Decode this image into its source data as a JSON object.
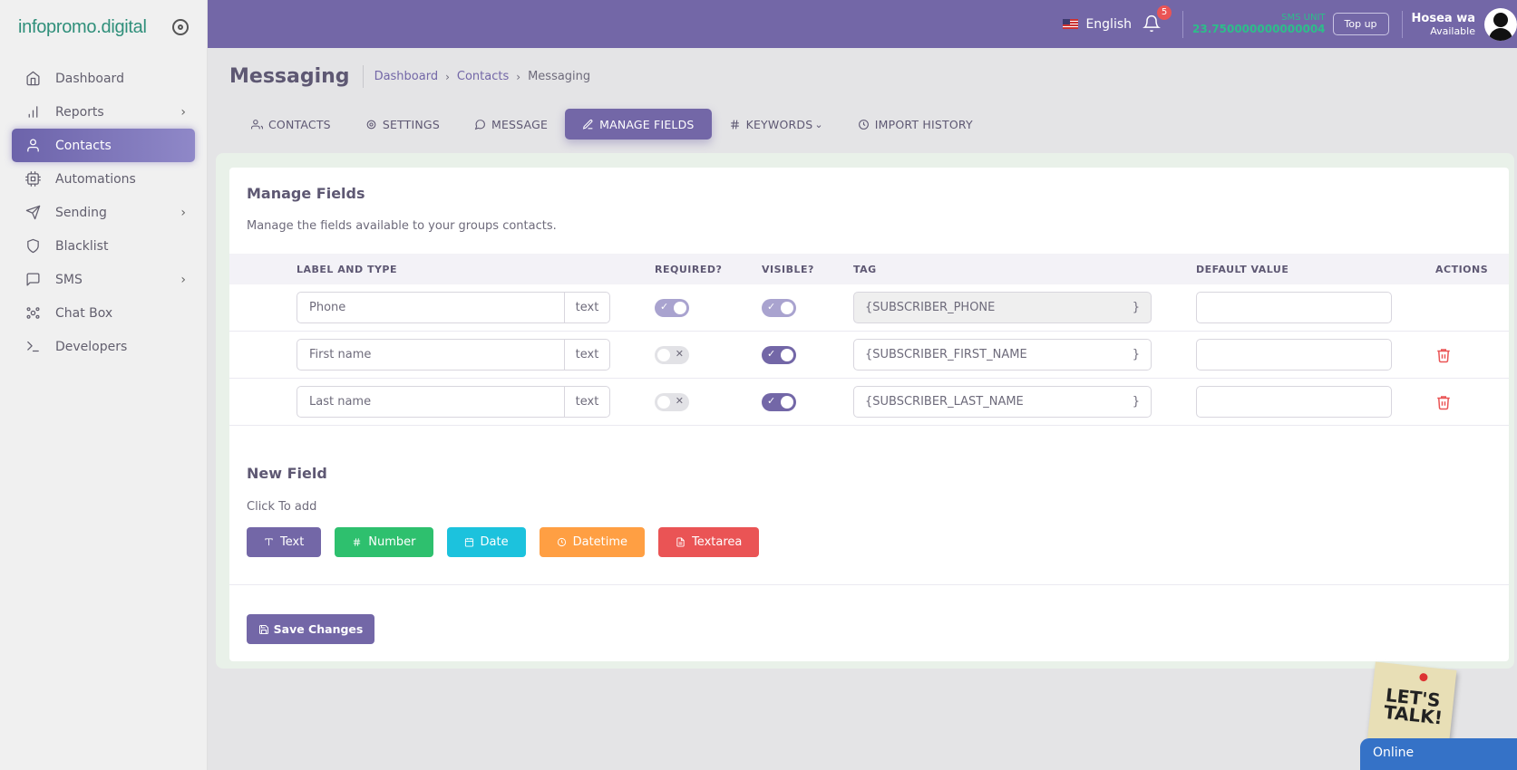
{
  "brand": {
    "name": "infopromo.digital"
  },
  "sidebar": {
    "items": [
      {
        "label": "Dashboard",
        "icon": "home-icon",
        "has_arrow": false,
        "active": false
      },
      {
        "label": "Reports",
        "icon": "bar-chart-icon",
        "has_arrow": true,
        "active": false
      },
      {
        "label": "Contacts",
        "icon": "user-icon",
        "has_arrow": false,
        "active": true
      },
      {
        "label": "Automations",
        "icon": "cpu-icon",
        "has_arrow": false,
        "active": false
      },
      {
        "label": "Sending",
        "icon": "send-icon",
        "has_arrow": true,
        "active": false
      },
      {
        "label": "Blacklist",
        "icon": "shield-icon",
        "has_arrow": false,
        "active": false
      },
      {
        "label": "SMS",
        "icon": "message-square-icon",
        "has_arrow": true,
        "active": false
      },
      {
        "label": "Chat Box",
        "icon": "chat-box-icon",
        "has_arrow": false,
        "active": false
      },
      {
        "label": "Developers",
        "icon": "terminal-icon",
        "has_arrow": false,
        "active": false
      }
    ]
  },
  "header": {
    "language": "English",
    "notification_count": "5",
    "sms_unit_label": "SMS UNIT",
    "sms_unit_value": "23.750000000000004",
    "topup_label": "Top up",
    "user_name": "Hosea wa",
    "user_status": "Available"
  },
  "page": {
    "title": "Messaging",
    "breadcrumb": [
      "Dashboard",
      "Contacts",
      "Messaging"
    ]
  },
  "tabs": [
    {
      "label": "CONTACTS",
      "icon": "users-icon",
      "active": false
    },
    {
      "label": "SETTINGS",
      "icon": "settings-icon",
      "active": false
    },
    {
      "label": "MESSAGE",
      "icon": "message-circle-icon",
      "active": false
    },
    {
      "label": "MANAGE FIELDS",
      "icon": "edit-icon",
      "active": true
    },
    {
      "label": "KEYWORDS",
      "icon": "hash-icon",
      "active": false,
      "dropdown": true
    },
    {
      "label": "IMPORT HISTORY",
      "icon": "clock-icon",
      "active": false
    }
  ],
  "manage_fields": {
    "title": "Manage Fields",
    "subtitle": "Manage the fields available to your groups contacts.",
    "columns": [
      "LABEL AND TYPE",
      "REQUIRED?",
      "VISIBLE?",
      "TAG",
      "DEFAULT VALUE",
      "ACTIONS"
    ],
    "rows": [
      {
        "label": "Phone",
        "type": "text",
        "required": true,
        "required_disabled": true,
        "visible": true,
        "visible_disabled": true,
        "tag": "{SUBSCRIBER_PHONE",
        "tag_close": "}",
        "default_value": "",
        "deletable": false
      },
      {
        "label": "First name",
        "type": "text",
        "required": false,
        "visible": true,
        "tag": "{SUBSCRIBER_FIRST_NAME",
        "tag_close": "}",
        "default_value": "",
        "deletable": true
      },
      {
        "label": "Last name",
        "type": "text",
        "required": false,
        "visible": true,
        "tag": "{SUBSCRIBER_LAST_NAME",
        "tag_close": "}",
        "default_value": "",
        "deletable": true
      }
    ]
  },
  "new_field": {
    "title": "New Field",
    "subtitle": "Click To add",
    "buttons": [
      {
        "label": "Text",
        "icon": "type-icon",
        "color": "#7367a7"
      },
      {
        "label": "Number",
        "icon": "hash-icon",
        "color": "#2ec06e"
      },
      {
        "label": "Date",
        "icon": "calendar-icon",
        "color": "#1cc2dd"
      },
      {
        "label": "Datetime",
        "icon": "clock-icon",
        "color": "#ff9f43"
      },
      {
        "label": "Textarea",
        "icon": "file-text-icon",
        "color": "#ea5455"
      }
    ]
  },
  "save_label": "Save Changes",
  "chat_widget": {
    "sticker_text": "LET'S TALK!",
    "status": "Online"
  }
}
